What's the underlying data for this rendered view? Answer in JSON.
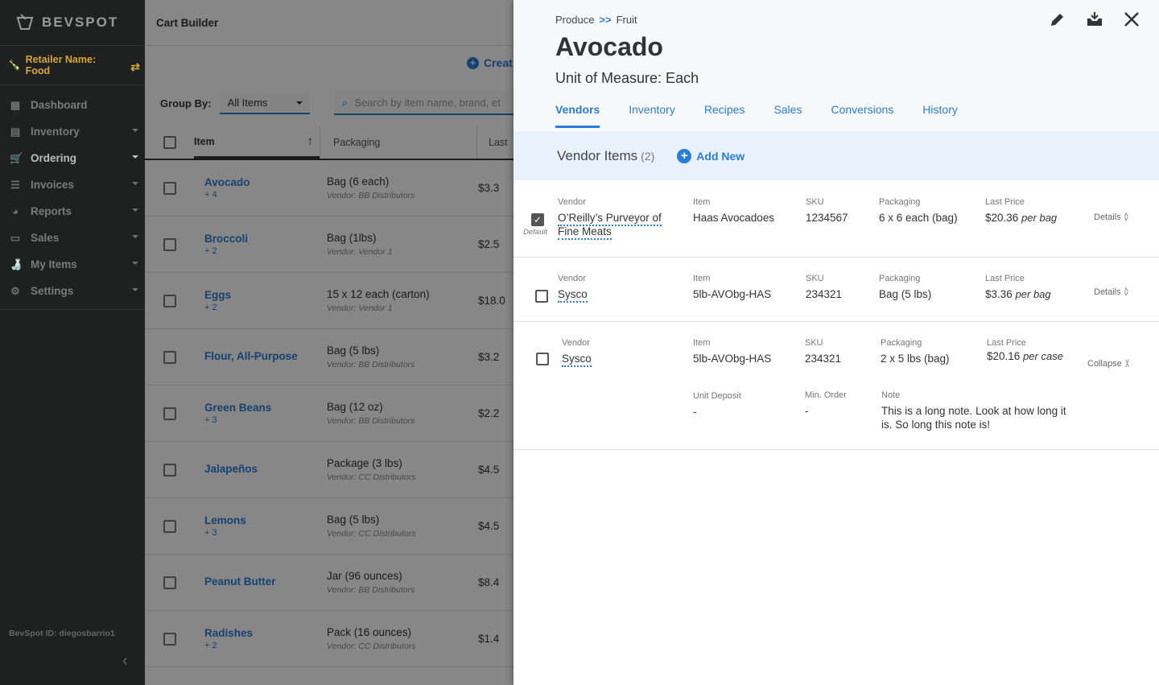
{
  "brand": {
    "name": "BEVSPOT"
  },
  "sidebar": {
    "retailer_label": "Retailer Name: Food",
    "items": [
      {
        "label": "Dashboard",
        "icon": "dashboard-icon"
      },
      {
        "label": "Inventory",
        "icon": "clipboard-icon"
      },
      {
        "label": "Ordering",
        "icon": "cart-icon"
      },
      {
        "label": "Invoices",
        "icon": "invoice-icon"
      },
      {
        "label": "Reports",
        "icon": "pie-chart-icon"
      },
      {
        "label": "Sales",
        "icon": "credit-card-icon"
      },
      {
        "label": "My Items",
        "icon": "bottle-icon"
      },
      {
        "label": "Settings",
        "icon": "gear-icon"
      }
    ],
    "bevspot_id": "BevSpot ID: diegosbarrio1"
  },
  "main": {
    "header": "Cart Builder",
    "create_label": "Creat",
    "group_by_label": "Group By:",
    "group_by_value": "All Items",
    "search_placeholder": "Search by item name, brand, et",
    "columns": {
      "item": "Item",
      "packaging": "Packaging",
      "last": "Last"
    },
    "rows": [
      {
        "name": "Avocado",
        "more": "+ 4",
        "pack": "Bag (6 each)",
        "vendor": "Vendor: BB Distributors",
        "price": "$3.3"
      },
      {
        "name": "Broccoli",
        "more": "+ 2",
        "pack": "Bag (1lbs)",
        "vendor": "Vendor: Vendor 1",
        "price": "$2.5"
      },
      {
        "name": "Eggs",
        "more": "+ 2",
        "pack": "15 x 12 each (carton)",
        "vendor": "Vendor: Vendor 1",
        "price": "$18.0"
      },
      {
        "name": "Flour, All-Purpose",
        "more": "",
        "pack": "Bag (5 lbs)",
        "vendor": "Vendor: BB Distributors",
        "price": "$3.2"
      },
      {
        "name": "Green Beans",
        "more": "+ 3",
        "pack": "Bag (12 oz)",
        "vendor": "Vendor: BB Distributors",
        "price": "$2.2"
      },
      {
        "name": "Jalapeños",
        "more": "",
        "pack": "Package (3 lbs)",
        "vendor": "Vendor: CC Distributors",
        "price": "$4.5"
      },
      {
        "name": "Lemons",
        "more": "+ 3",
        "pack": "Bag (5 lbs)",
        "vendor": "Vendor: CC Distributors",
        "price": "$4.5"
      },
      {
        "name": "Peanut Butter",
        "more": "",
        "pack": "Jar (96 ounces)",
        "vendor": "Vendor: BB Distributors",
        "price": "$8.4"
      },
      {
        "name": "Radishes",
        "more": "+ 2",
        "pack": "Pack (16 ounces)",
        "vendor": "Vendor: CC Distributors",
        "price": "$1.4"
      }
    ]
  },
  "panel": {
    "breadcrumb": {
      "parent": "Produce",
      "separator": ">>",
      "child": "Fruit"
    },
    "title": "Avocado",
    "unit_of_measure": "Unit of Measure: Each",
    "tabs": [
      "Vendors",
      "Inventory",
      "Recipes",
      "Sales",
      "Conversions",
      "History"
    ],
    "vendor_items_title": "Vendor Items",
    "vendor_items_count": "(2)",
    "add_new": "Add New",
    "labels": {
      "vendor": "Vendor",
      "item": "Item",
      "sku": "SKU",
      "packaging": "Packaging",
      "last_price": "Last Price",
      "unit_deposit": "Unit Deposit",
      "min_order": "Min. Order",
      "note": "Note"
    },
    "default_label": "Default",
    "vendor_rows": [
      {
        "vendor": "O’Reilly’s Purveyor of Fine Meats",
        "item": "Haas Avocadoes",
        "sku": "1234567",
        "packaging": "6 x 6 each (bag)",
        "price": "$20.36",
        "per": "per bag",
        "toggle": "Details",
        "checked": true
      },
      {
        "vendor": "Sysco",
        "item": "5lb-AVObg-HAS",
        "sku": "234321",
        "packaging": "Bag (5 lbs)",
        "price": "$3.36",
        "per": "per bag",
        "toggle": "Details",
        "checked": false
      },
      {
        "vendor": "Sysco",
        "item": "5lb-AVObg-HAS",
        "sku": "234321",
        "packaging": "2 x 5 lbs (bag)",
        "price": "$20.16",
        "per": "per case",
        "toggle": "Collapse",
        "checked": false,
        "unit_deposit": "-",
        "min_order": "-",
        "note": "This is a long note. Look at how long it is. So long this note is!"
      }
    ]
  }
}
